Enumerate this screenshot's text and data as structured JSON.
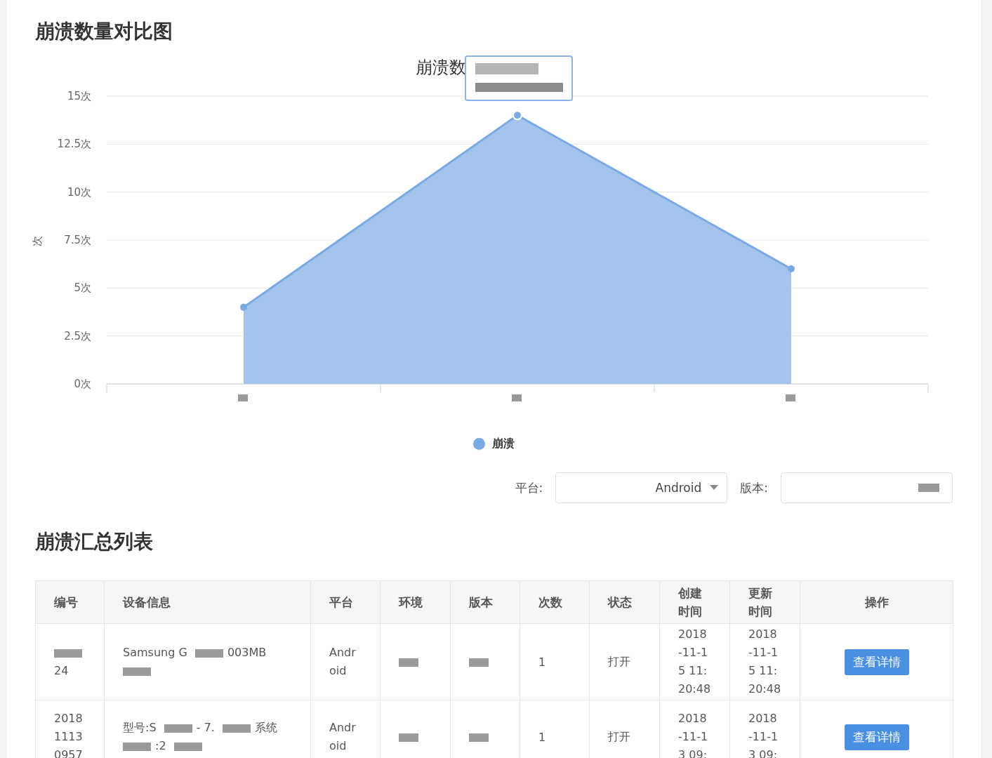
{
  "chart_section": {
    "title": "崩溃数量对比图",
    "chart_data": {
      "type": "area",
      "title": "崩溃数",
      "ylabel": "次",
      "series": [
        {
          "name": "崩溃",
          "color": "#7aaae6",
          "values": [
            4,
            14,
            6
          ]
        }
      ],
      "ylim": [
        0,
        15
      ],
      "grid": true,
      "yticks": [
        {
          "value": 0,
          "label": "0次"
        },
        {
          "value": 2.5,
          "label": "2.5次"
        },
        {
          "value": 5,
          "label": "5次"
        },
        {
          "value": 7.5,
          "label": "7.5次"
        },
        {
          "value": 10,
          "label": "10次"
        },
        {
          "value": 12.5,
          "label": "12.5次"
        },
        {
          "value": 15,
          "label": "15次"
        }
      ]
    }
  },
  "filters": [
    {
      "label": "平台:",
      "kind": "select",
      "value": "Android"
    },
    {
      "label": "版本:",
      "kind": "redacted"
    }
  ],
  "table_section": {
    "title": "崩溃汇总列表",
    "columns": [
      "编号",
      "设备信息",
      "平台",
      "环境",
      "版本",
      "次数",
      "状态",
      "创建时间",
      "更新时间",
      "操作"
    ],
    "rows": [
      {
        "id": "24",
        "device_lines": [
          "Samsung G",
          "003MB"
        ],
        "platform": "Android",
        "count": "1",
        "status": "打开",
        "created": "2018-11-15 11:20:48",
        "updated": "2018-11-15 11:20:48",
        "action": "查看详情"
      },
      {
        "id": "201811130957",
        "device_lines": [
          "型号:S",
          "- 7.",
          "系统",
          ":2"
        ],
        "platform": "Android",
        "count": "1",
        "status": "打开",
        "created": "2018-11-13 09:",
        "updated": "2018-11-13 09:",
        "action": "查看详情"
      }
    ]
  }
}
